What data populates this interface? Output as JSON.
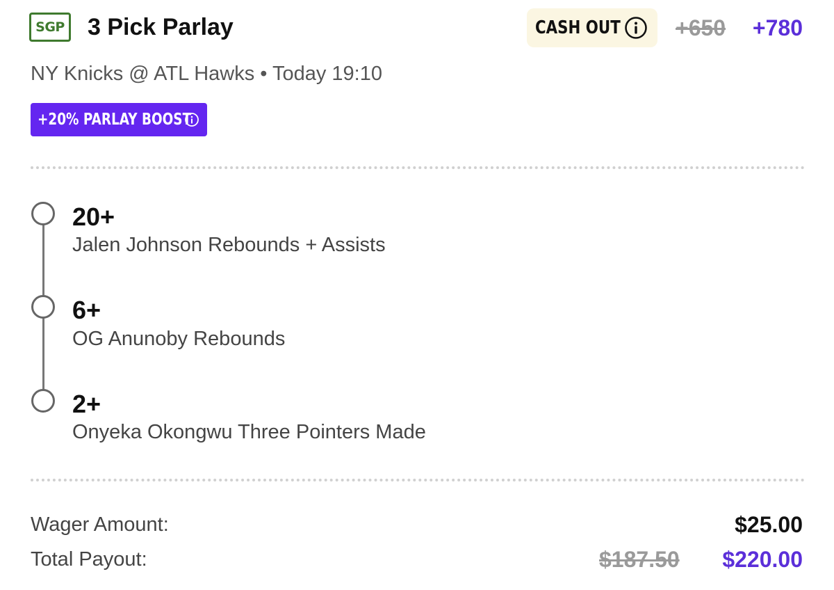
{
  "header": {
    "badge": "SGP",
    "title": "3 Pick Parlay",
    "cash_out_label": "CASH OUT",
    "odds_original": "+650",
    "odds_boosted": "+780",
    "matchup": "NY Knicks @ ATL Hawks • Today 19:10",
    "boost_label": "+20% PARLAY BOOST"
  },
  "legs": [
    {
      "line": "20+",
      "description": "Jalen Johnson Rebounds + Assists"
    },
    {
      "line": "6+",
      "description": "OG Anunoby Rebounds"
    },
    {
      "line": "2+",
      "description": "Onyeka Okongwu Three Pointers Made"
    }
  ],
  "summary": {
    "wager_label": "Wager Amount:",
    "wager_value": "$25.00",
    "payout_label": "Total Payout:",
    "payout_original": "$187.50",
    "payout_boosted": "$220.00"
  },
  "colors": {
    "sgp_green": "#3f7a2e",
    "boost_purple": "#6426f0",
    "odds_purple": "#5b2fd9",
    "cash_out_bg": "#fbf6e2",
    "struck_gray": "#9a9a9a"
  },
  "icons": {
    "cash_out_info": "info-circle-icon",
    "boost_info": "info-circle-icon",
    "leg_marker": "open-circle-icon"
  }
}
